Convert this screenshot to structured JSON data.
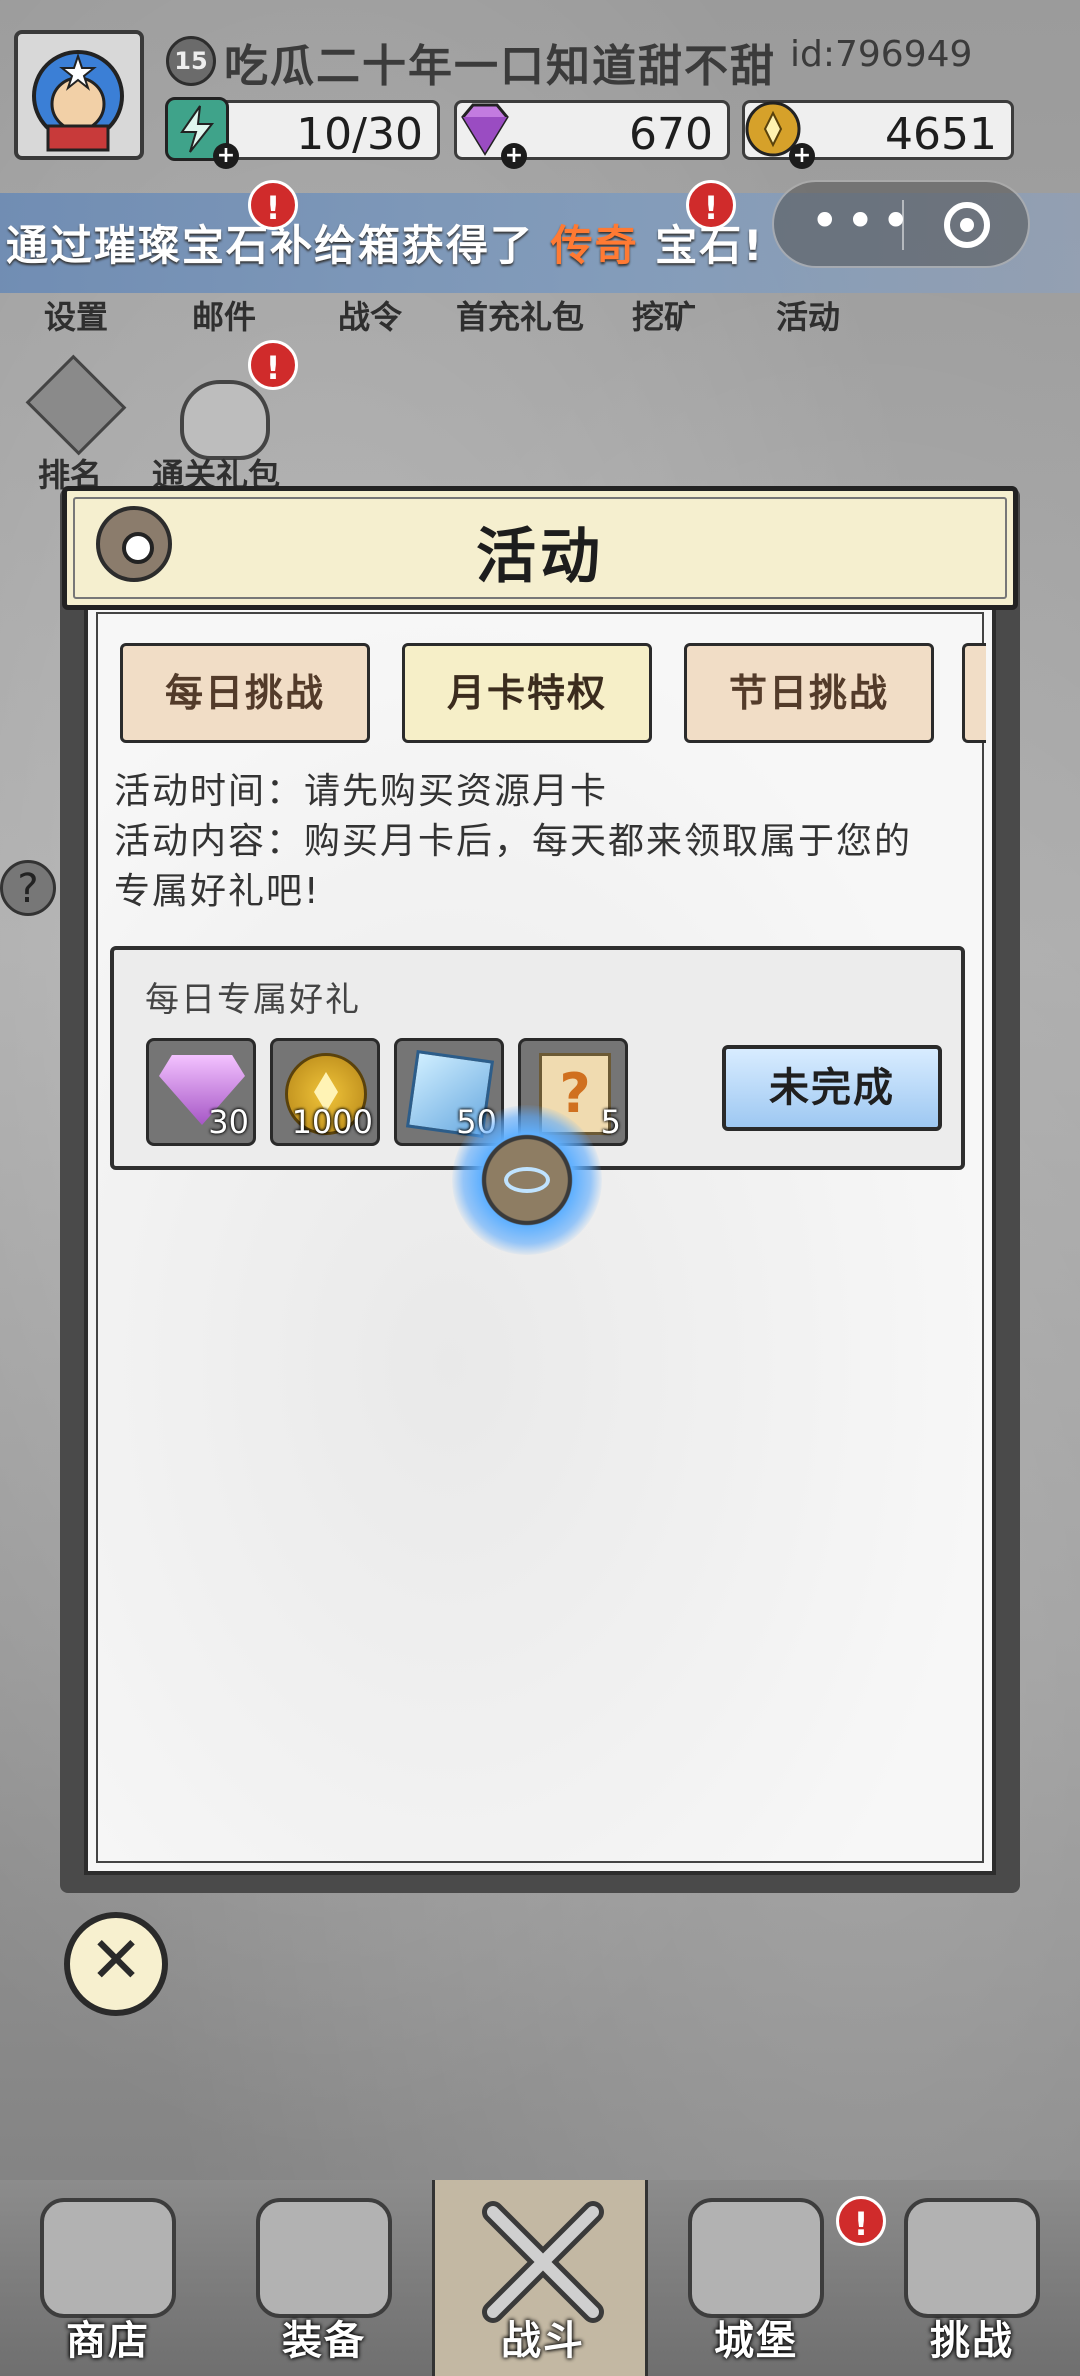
{
  "player": {
    "level": "15",
    "name": "吃瓜二十年一口知道甜不甜",
    "id": "id:796949"
  },
  "resources": [
    {
      "name": "energy",
      "value": "10/30",
      "icon": "lightning-icon",
      "color": "#3fa38a"
    },
    {
      "name": "gems",
      "value": "670",
      "icon": "gem-icon",
      "color": "#b45cd8"
    },
    {
      "name": "gold",
      "value": "4651",
      "icon": "coin-icon",
      "color": "#d6a12a"
    }
  ],
  "banner": {
    "prefix": "通过璀璨宝石补给箱获得了 ",
    "highlight": "传奇",
    "suffix": " 宝石!"
  },
  "menu": {
    "items": [
      "设置",
      "邮件",
      "战令",
      "首充礼包",
      "挖矿",
      "活动"
    ],
    "row2": [
      "排名",
      "通关礼包"
    ],
    "alert": "!"
  },
  "modal": {
    "title": "活动",
    "tabs": [
      "每日挑战",
      "月卡特权",
      "节日挑战"
    ],
    "active_tab": 1,
    "info_time": "活动时间：请先购买资源月卡",
    "info_content_1": "活动内容：购买月卡后，每天都来领取属于您的",
    "info_content_2": "专属好礼吧!",
    "reward_title": "每日专属好礼",
    "rewards": [
      {
        "icon": "gem-icon",
        "count": "30"
      },
      {
        "icon": "coin-icon",
        "count": "1000"
      },
      {
        "icon": "crystal-icon",
        "count": "50"
      },
      {
        "icon": "scroll-icon",
        "count": "5"
      }
    ],
    "status_button": "未完成"
  },
  "nav": {
    "items": [
      "商店",
      "装备",
      "战斗",
      "城堡",
      "挑战"
    ],
    "active": 2
  }
}
